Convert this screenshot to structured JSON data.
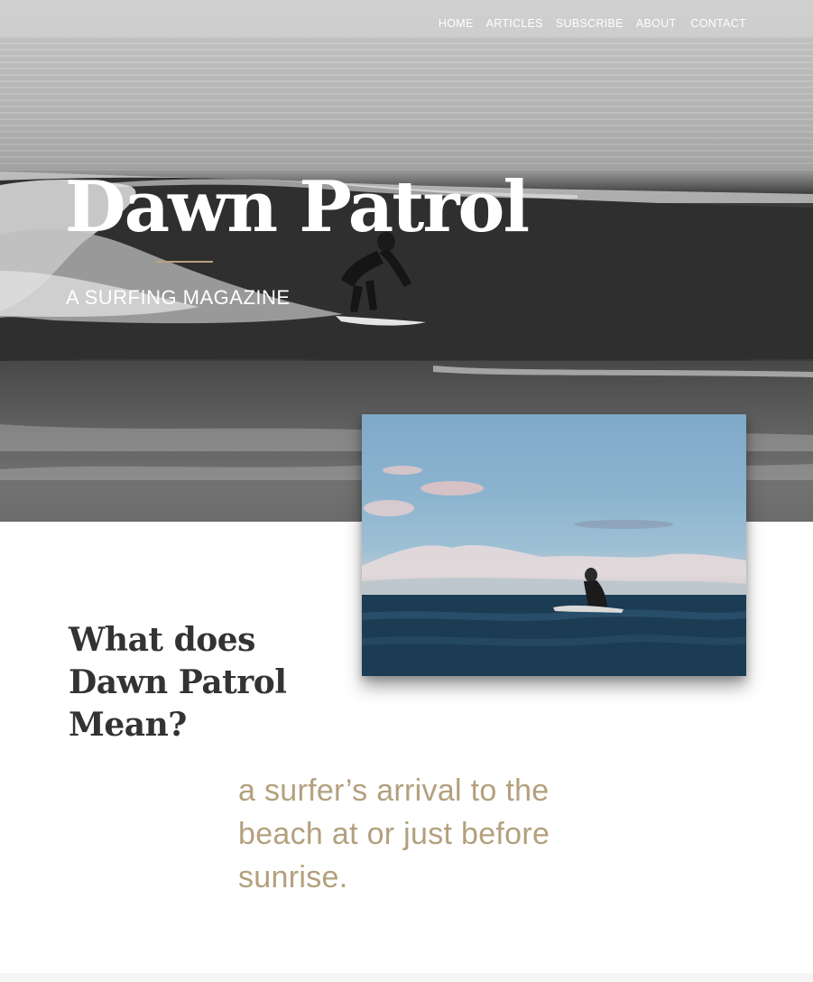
{
  "nav": {
    "items": [
      "HOME",
      "ARTICLES",
      "SUBSCRIBE",
      "ABOUT",
      "CONTACT"
    ]
  },
  "hero": {
    "title": "Dawn Patrol",
    "subtitle": "A SURFING MAGAZINE",
    "rule_color": "#b9a27e",
    "background_image": "black-and-white photo of surfer riding a wave"
  },
  "feature_image": {
    "description": "surfer sitting on board in blue ocean under clouds"
  },
  "section": {
    "heading": "What does Dawn Patrol Mean?",
    "definition": "a surfer’s arrival to the beach at or just before sunrise."
  },
  "colors": {
    "accent": "#b3a07e",
    "heading": "#333333"
  }
}
